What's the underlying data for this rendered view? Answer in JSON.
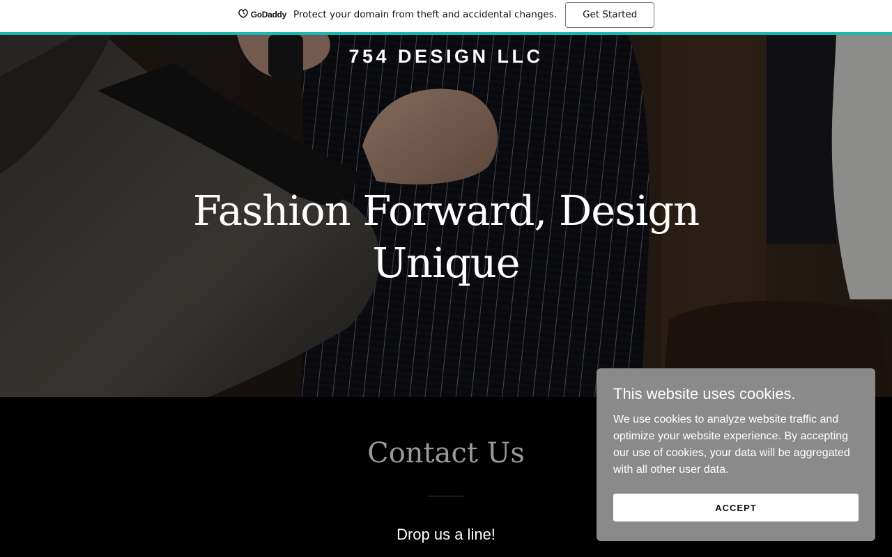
{
  "promo": {
    "logo_text": "GoDaddy",
    "message": "Protect your domain from theft and accidental changes.",
    "button_label": "Get Started",
    "accent_color": "#1bb7b0"
  },
  "hero": {
    "site_title": "754 DESIGN LLC",
    "headline": "Fashion Forward, Design Unique"
  },
  "contact": {
    "title": "Contact Us",
    "subtitle": "Drop us a line!"
  },
  "cookie_banner": {
    "title": "This website uses cookies.",
    "body": "We use cookies to analyze website traffic and optimize your website experience. By accepting our use of cookies, your data will be aggregated with all other user data.",
    "accept_label": "ACCEPT",
    "background_color": "#8a8a8a"
  }
}
